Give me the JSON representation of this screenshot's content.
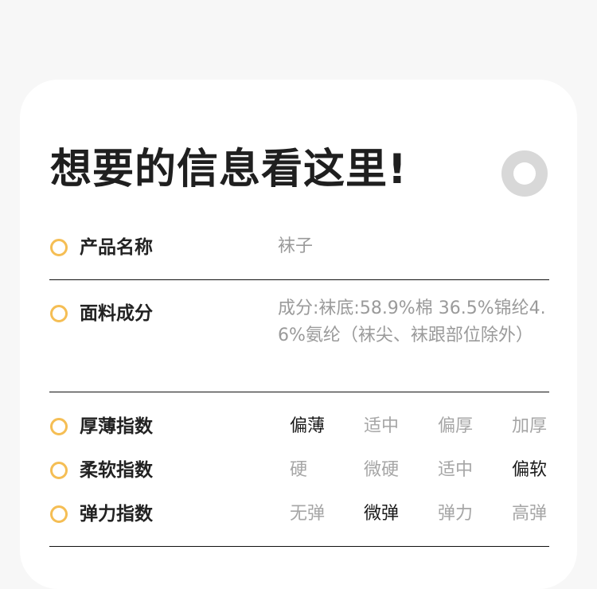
{
  "title": "想要的信息看这里!",
  "product": {
    "label": "产品名称",
    "value": "袜子"
  },
  "material": {
    "label": "面料成分",
    "value": "成分:袜底:58.9%棉 36.5%锦纶4.6%氨纶（袜尖、袜跟部位除外）"
  },
  "thickness": {
    "label": "厚薄指数",
    "options": [
      "偏薄",
      "适中",
      "偏厚",
      "加厚"
    ],
    "selected": "偏薄"
  },
  "softness": {
    "label": "柔软指数",
    "options": [
      "硬",
      "微硬",
      "适中",
      "偏软"
    ],
    "selected": "偏软"
  },
  "elasticity": {
    "label": "弹力指数",
    "options": [
      "无弹",
      "微弹",
      "弹力",
      "高弹"
    ],
    "selected": "微弹"
  },
  "colors": {
    "accent": "#f5be54",
    "text": "#222222",
    "muted": "#9a9a9a"
  }
}
